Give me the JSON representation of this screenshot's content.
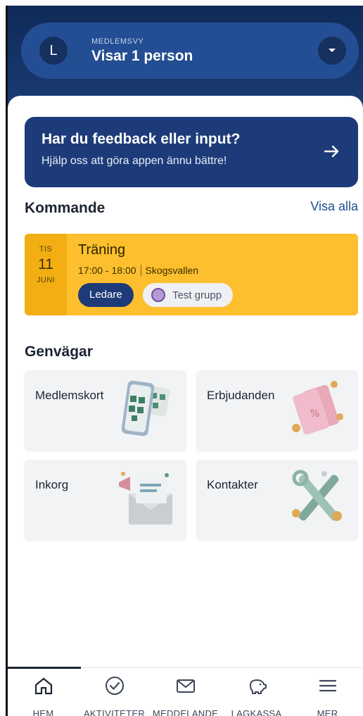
{
  "header": {
    "avatar_letter": "L",
    "kicker": "MEDLEMSVY",
    "title": "Visar 1 person"
  },
  "feedback": {
    "title": "Har du feedback eller input?",
    "subtitle": "Hjälp oss att göra appen ännu bättre!",
    "arrow_icon": "arrow-right-icon"
  },
  "upcoming": {
    "title": "Kommande",
    "see_all": "Visa alla",
    "event": {
      "weekday": "TIS",
      "day": "11",
      "month": "JUNI",
      "title": "Träning",
      "time": "17:00 - 18:00",
      "location": "Skogsvallen",
      "role_chip": "Ledare",
      "group_chip": "Test grupp"
    }
  },
  "shortcuts": {
    "title": "Genvägar",
    "items": [
      {
        "label": "Medlemskort",
        "icon": "phone-qr-icon"
      },
      {
        "label": "Erbjudanden",
        "icon": "coupon-icon"
      },
      {
        "label": "Inkorg",
        "icon": "envelope-megaphone-icon"
      },
      {
        "label": "Kontakter",
        "icon": "tools-icon"
      }
    ]
  },
  "nav": {
    "items": [
      {
        "label": "HEM",
        "icon": "home-icon",
        "active": true
      },
      {
        "label": "AKTIVITETER",
        "icon": "check-circle-icon"
      },
      {
        "label": "MEDDELANDE",
        "icon": "mail-icon"
      },
      {
        "label": "LAGKASSA",
        "icon": "piggy-bank-icon"
      },
      {
        "label": "MER",
        "icon": "menu-icon"
      }
    ]
  },
  "colors": {
    "header_bg": "#0f2a57",
    "feedback_bg": "#1d3b78",
    "event_bg": "#fdbf2d",
    "link": "#1d4f91"
  }
}
